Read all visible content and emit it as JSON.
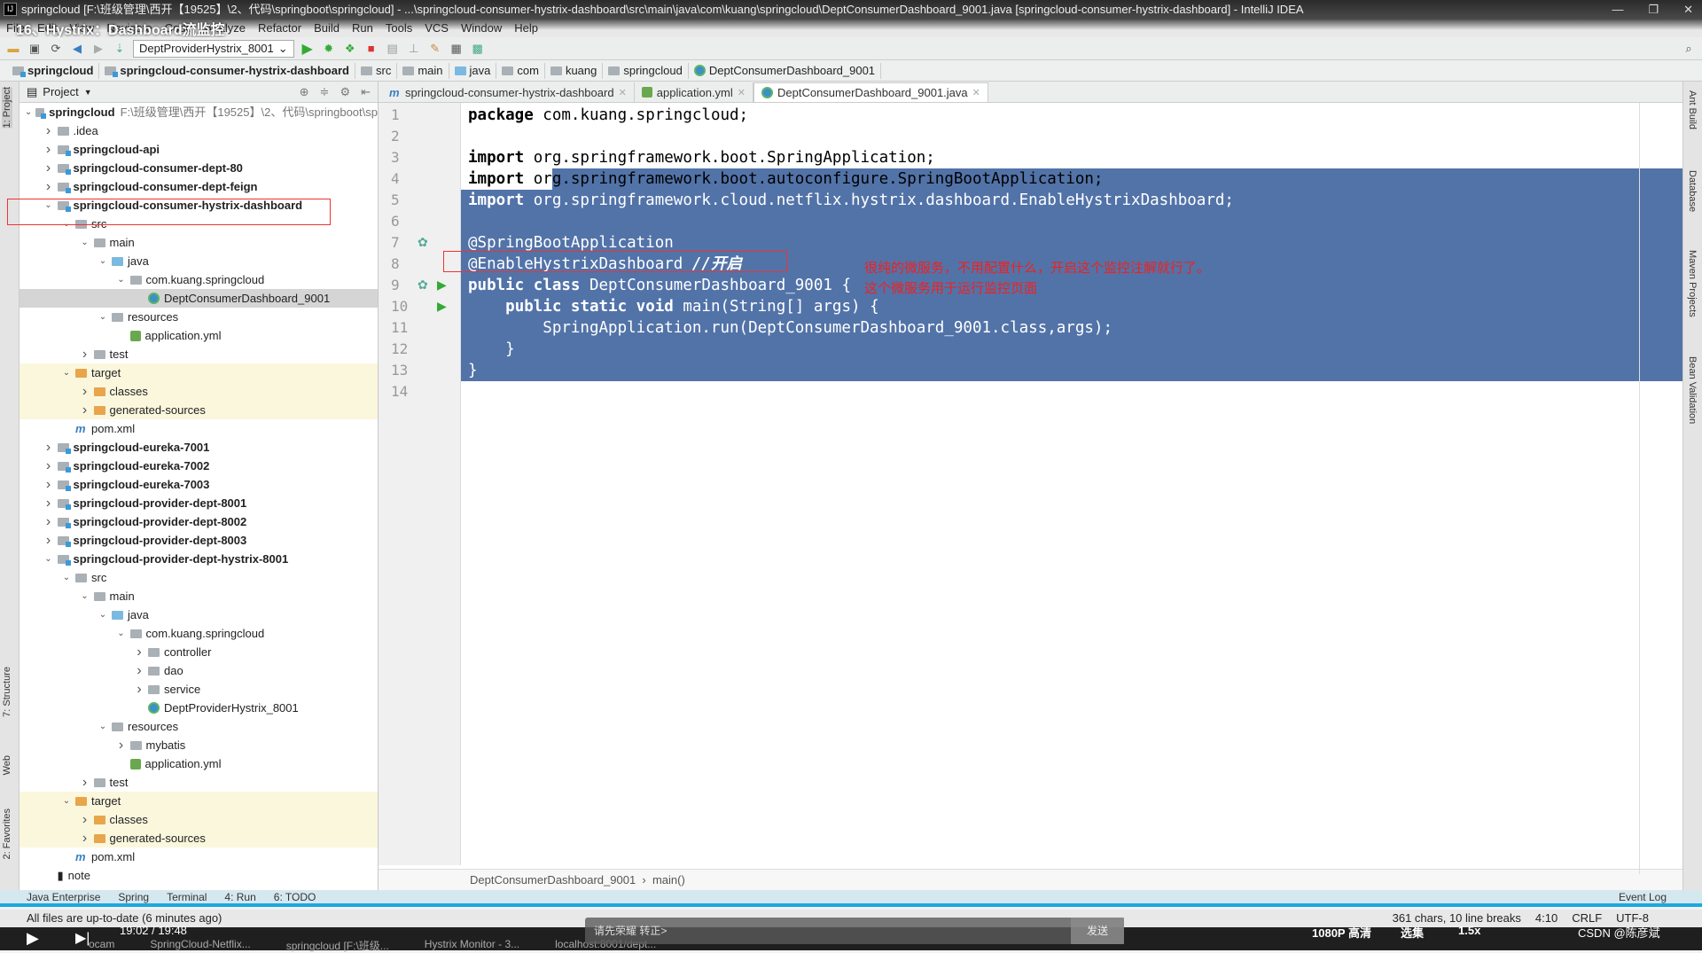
{
  "window": {
    "title": "springcloud [F:\\班级管理\\西开【19525】\\2、代码\\springboot\\springcloud] - ...\\springcloud-consumer-hystrix-dashboard\\src\\main\\java\\com\\kuang\\springcloud\\DeptConsumerDashboard_9001.java [springcloud-consumer-hystrix-dashboard] - IntelliJ IDEA",
    "logo": "IJ"
  },
  "video_title": "16、Hystrix：Dashboard流监控",
  "menu": [
    "File",
    "Edit",
    "View",
    "Navigate",
    "Code",
    "Analyze",
    "Refactor",
    "Build",
    "Run",
    "Tools",
    "VCS",
    "Window",
    "Help"
  ],
  "toolbar": {
    "run_config": "DeptProviderHystrix_8001"
  },
  "breadcrumb": [
    "springcloud",
    "springcloud-consumer-hystrix-dashboard",
    "src",
    "main",
    "java",
    "com",
    "kuang",
    "springcloud",
    "DeptConsumerDashboard_9001"
  ],
  "left_stripe": {
    "project": "1: Project",
    "structure": "7: Structure",
    "web": "Web",
    "favorites": "2: Favorites"
  },
  "right_stripe": [
    "Ant Build",
    "Database",
    "Maven Projects",
    "Bean Validation"
  ],
  "project": {
    "title": "Project",
    "tree": [
      {
        "d": 0,
        "label": "springcloud",
        "hint": "F:\\班级管理\\西开【19525】\\2、代码\\springboot\\sp",
        "bold": true,
        "icon": "module",
        "exp": "open"
      },
      {
        "d": 1,
        "label": ".idea",
        "icon": "folder",
        "exp": "closed"
      },
      {
        "d": 1,
        "label": "springcloud-api",
        "bold": true,
        "icon": "module",
        "exp": "closed"
      },
      {
        "d": 1,
        "label": "springcloud-consumer-dept-80",
        "bold": true,
        "icon": "module",
        "exp": "closed"
      },
      {
        "d": 1,
        "label": "springcloud-consumer-dept-feign",
        "bold": true,
        "icon": "module",
        "exp": "closed"
      },
      {
        "d": 1,
        "label": "springcloud-consumer-hystrix-dashboard",
        "bold": true,
        "icon": "module",
        "exp": "open"
      },
      {
        "d": 2,
        "label": "src",
        "icon": "folder",
        "exp": "open"
      },
      {
        "d": 3,
        "label": "main",
        "icon": "folder",
        "exp": "open"
      },
      {
        "d": 4,
        "label": "java",
        "icon": "src",
        "exp": "open"
      },
      {
        "d": 5,
        "label": "com.kuang.springcloud",
        "icon": "package",
        "exp": "open"
      },
      {
        "d": 6,
        "label": "DeptConsumerDashboard_9001",
        "icon": "java",
        "sel": true
      },
      {
        "d": 4,
        "label": "resources",
        "icon": "folder",
        "exp": "open"
      },
      {
        "d": 5,
        "label": "application.yml",
        "icon": "yml"
      },
      {
        "d": 3,
        "label": "test",
        "icon": "folder",
        "exp": "closed"
      },
      {
        "d": 2,
        "label": "target",
        "icon": "target",
        "exp": "open",
        "target": true
      },
      {
        "d": 3,
        "label": "classes",
        "icon": "target",
        "exp": "closed",
        "target": true
      },
      {
        "d": 3,
        "label": "generated-sources",
        "icon": "target",
        "exp": "closed",
        "target": true
      },
      {
        "d": 2,
        "label": "pom.xml",
        "icon": "maven"
      },
      {
        "d": 1,
        "label": "springcloud-eureka-7001",
        "bold": true,
        "icon": "module",
        "exp": "closed"
      },
      {
        "d": 1,
        "label": "springcloud-eureka-7002",
        "bold": true,
        "icon": "module",
        "exp": "closed"
      },
      {
        "d": 1,
        "label": "springcloud-eureka-7003",
        "bold": true,
        "icon": "module",
        "exp": "closed"
      },
      {
        "d": 1,
        "label": "springcloud-provider-dept-8001",
        "bold": true,
        "icon": "module",
        "exp": "closed"
      },
      {
        "d": 1,
        "label": "springcloud-provider-dept-8002",
        "bold": true,
        "icon": "module",
        "exp": "closed"
      },
      {
        "d": 1,
        "label": "springcloud-provider-dept-8003",
        "bold": true,
        "icon": "module",
        "exp": "closed"
      },
      {
        "d": 1,
        "label": "springcloud-provider-dept-hystrix-8001",
        "bold": true,
        "icon": "module",
        "exp": "open"
      },
      {
        "d": 2,
        "label": "src",
        "icon": "folder",
        "exp": "open"
      },
      {
        "d": 3,
        "label": "main",
        "icon": "folder",
        "exp": "open"
      },
      {
        "d": 4,
        "label": "java",
        "icon": "src",
        "exp": "open"
      },
      {
        "d": 5,
        "label": "com.kuang.springcloud",
        "icon": "package",
        "exp": "open"
      },
      {
        "d": 6,
        "label": "controller",
        "icon": "package",
        "exp": "closed"
      },
      {
        "d": 6,
        "label": "dao",
        "icon": "package",
        "exp": "closed"
      },
      {
        "d": 6,
        "label": "service",
        "icon": "package",
        "exp": "closed"
      },
      {
        "d": 6,
        "label": "DeptProviderHystrix_8001",
        "icon": "java"
      },
      {
        "d": 4,
        "label": "resources",
        "icon": "folder",
        "exp": "open"
      },
      {
        "d": 5,
        "label": "mybatis",
        "icon": "folder",
        "exp": "closed"
      },
      {
        "d": 5,
        "label": "application.yml",
        "icon": "yml"
      },
      {
        "d": 3,
        "label": "test",
        "icon": "folder",
        "exp": "closed"
      },
      {
        "d": 2,
        "label": "target",
        "icon": "target",
        "exp": "open",
        "target": true
      },
      {
        "d": 3,
        "label": "classes",
        "icon": "target",
        "exp": "closed",
        "target": true
      },
      {
        "d": 3,
        "label": "generated-sources",
        "icon": "target",
        "exp": "closed",
        "target": true
      },
      {
        "d": 2,
        "label": "pom.xml",
        "icon": "maven"
      },
      {
        "d": 1,
        "label": "note",
        "icon": "file"
      }
    ]
  },
  "tabs": [
    {
      "label": "springcloud-consumer-hystrix-dashboard",
      "icon": "maven"
    },
    {
      "label": "application.yml",
      "icon": "yml"
    },
    {
      "label": "DeptConsumerDashboard_9001.java",
      "icon": "java",
      "active": true
    }
  ],
  "code": [
    "package com.kuang.springcloud;",
    "",
    "import org.springframework.boot.SpringApplication;",
    "import org.springframework.boot.autoconfigure.SpringBootApplication;",
    "import org.springframework.cloud.netflix.hystrix.dashboard.EnableHystrixDashboard;",
    "",
    "@SpringBootApplication",
    "@EnableHystrixDashboard //开启",
    "public class DeptConsumerDashboard_9001 {",
    "    public static void main(String[] args) {",
    "        SpringApplication.run(DeptConsumerDashboard_9001.class,args);",
    "    }",
    "}",
    ""
  ],
  "selection_color": "#5273a8",
  "annotations": [
    "很纯的微服务，不用配置什么，开启这个监控注解就行了。",
    "这个微服务用于运行监控页面"
  ],
  "editor_breadcrumb": [
    "DeptConsumerDashboard_9001",
    "main()"
  ],
  "tool_windows": [
    "Java Enterprise",
    "Spring",
    "Terminal",
    "4: Run",
    "6: TODO"
  ],
  "event_log": "Event Log",
  "status": {
    "message": "All files are up-to-date (6 minutes ago)",
    "chars": "361 chars, 10 line breaks",
    "pos": "4:10",
    "crlf": "CRLF",
    "enc": "UTF-8"
  },
  "player": {
    "time": "19:02 / 19:48",
    "danmu_placeholder": "请先荣耀 转正>",
    "send": "发送",
    "quality": "1080P 高清",
    "episodes": "选集",
    "speed": "1.5x",
    "watermark": "CSDN @陈彦斌"
  },
  "taskbar": [
    "ocam",
    "SpringCloud-Netflix...",
    "springcloud [F:\\班级...",
    "Hystrix Monitor - 3...",
    "localhost:8001/dept..."
  ]
}
